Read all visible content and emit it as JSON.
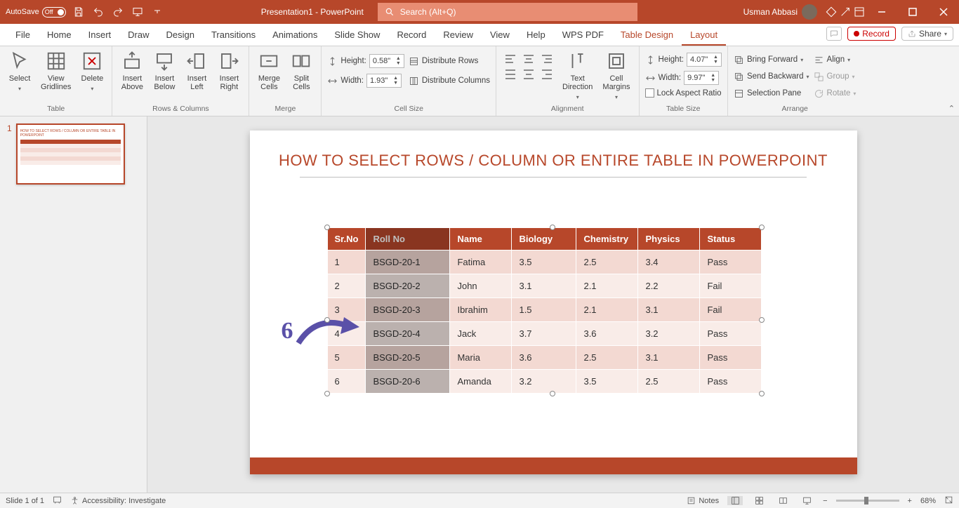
{
  "titlebar": {
    "autosave_label": "AutoSave",
    "autosave_state": "Off",
    "doc_title": "Presentation1 - PowerPoint",
    "search_placeholder": "Search (Alt+Q)",
    "user_name": "Usman Abbasi"
  },
  "menu": {
    "tabs": [
      "File",
      "Home",
      "Insert",
      "Draw",
      "Design",
      "Transitions",
      "Animations",
      "Slide Show",
      "Record",
      "Review",
      "View",
      "Help",
      "WPS PDF",
      "Table Design",
      "Layout"
    ],
    "active_tab": "Layout",
    "record_label": "Record",
    "share_label": "Share"
  },
  "ribbon": {
    "table": {
      "select": "Select",
      "view_gridlines": "View\nGridlines",
      "delete": "Delete",
      "label": "Table"
    },
    "rows_cols": {
      "insert_above": "Insert\nAbove",
      "insert_below": "Insert\nBelow",
      "insert_left": "Insert\nLeft",
      "insert_right": "Insert\nRight",
      "label": "Rows & Columns"
    },
    "merge": {
      "merge_cells": "Merge\nCells",
      "split_cells": "Split\nCells",
      "label": "Merge"
    },
    "cell_size": {
      "height_label": "Height:",
      "height_val": "0.58\"",
      "width_label": "Width:",
      "width_val": "1.93\"",
      "dist_rows": "Distribute Rows",
      "dist_cols": "Distribute Columns",
      "label": "Cell Size"
    },
    "alignment": {
      "text_direction": "Text\nDirection",
      "cell_margins": "Cell\nMargins",
      "label": "Alignment"
    },
    "table_size": {
      "height_label": "Height:",
      "height_val": "4.07\"",
      "width_label": "Width:",
      "width_val": "9.97\"",
      "lock_aspect": "Lock Aspect Ratio",
      "label": "Table Size"
    },
    "arrange": {
      "bring_forward": "Bring Forward",
      "send_backward": "Send Backward",
      "selection_pane": "Selection Pane",
      "align": "Align",
      "group": "Group",
      "rotate": "Rotate",
      "label": "Arrange"
    }
  },
  "slide": {
    "title": "HOW TO SELECT ROWS / COLUMN OR ENTIRE TABLE IN POWERPOINT",
    "annotation": "6",
    "headers": [
      "Sr.No",
      "Roll No",
      "Name",
      "Biology",
      "Chemistry",
      "Physics",
      "Status"
    ],
    "rows": [
      [
        "1",
        "BSGD-20-1",
        "Fatima",
        "3.5",
        "2.5",
        "3.4",
        "Pass"
      ],
      [
        "2",
        "BSGD-20-2",
        "John",
        "3.1",
        "2.1",
        "2.2",
        "Fail"
      ],
      [
        "3",
        "BSGD-20-3",
        "Ibrahim",
        "1.5",
        "2.1",
        "3.1",
        "Fail"
      ],
      [
        "4",
        "BSGD-20-4",
        "Jack",
        "3.7",
        "3.6",
        "3.2",
        "Pass"
      ],
      [
        "5",
        "BSGD-20-5",
        "Maria",
        "3.6",
        "2.5",
        "3.1",
        "Pass"
      ],
      [
        "6",
        "BSGD-20-6",
        "Amanda",
        "3.2",
        "3.5",
        "2.5",
        "Pass"
      ]
    ]
  },
  "status": {
    "slide_info": "Slide 1 of 1",
    "accessibility": "Accessibility: Investigate",
    "notes": "Notes",
    "zoom": "68%"
  },
  "thumb": {
    "num": "1"
  }
}
